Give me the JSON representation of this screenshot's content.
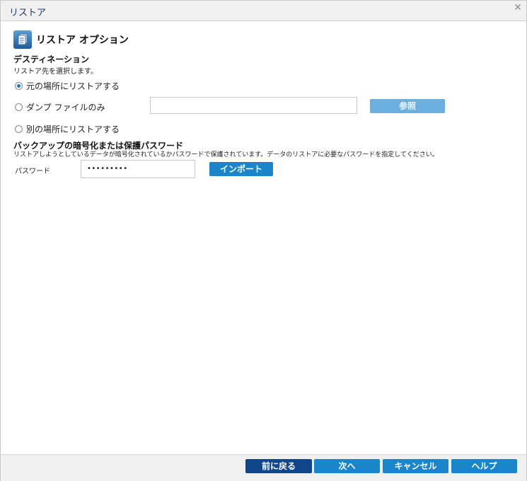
{
  "window": {
    "title": "リストア",
    "close_glyph": "✕"
  },
  "restore_options": {
    "title": "リストア オプション",
    "icon": "document-stack-icon"
  },
  "destination": {
    "heading": "デスティネーション",
    "description": "リストア先を選択します。",
    "options": [
      {
        "label": "元の場所にリストアする",
        "selected": true
      },
      {
        "label": "ダンプ ファイルのみ",
        "selected": false
      },
      {
        "label": "別の場所にリストアする",
        "selected": false
      }
    ],
    "path_value": "",
    "browse_label": "参照"
  },
  "encryption": {
    "heading": "バックアップの暗号化または保護パスワード",
    "description": "リストアしようとしているデータが暗号化されているかパスワードで保護されています。データのリストアに必要なパスワードを指定してください。",
    "password_label": "パスワード",
    "password_value": "•••••••••",
    "import_label": "インポート"
  },
  "footer": {
    "back_label": "前に戻る",
    "next_label": "次へ",
    "cancel_label": "キャンセル",
    "help_label": "ヘルプ"
  },
  "colors": {
    "accent": "#1a86c9",
    "dark_accent": "#11468c",
    "title_color": "#1b3a6b"
  }
}
